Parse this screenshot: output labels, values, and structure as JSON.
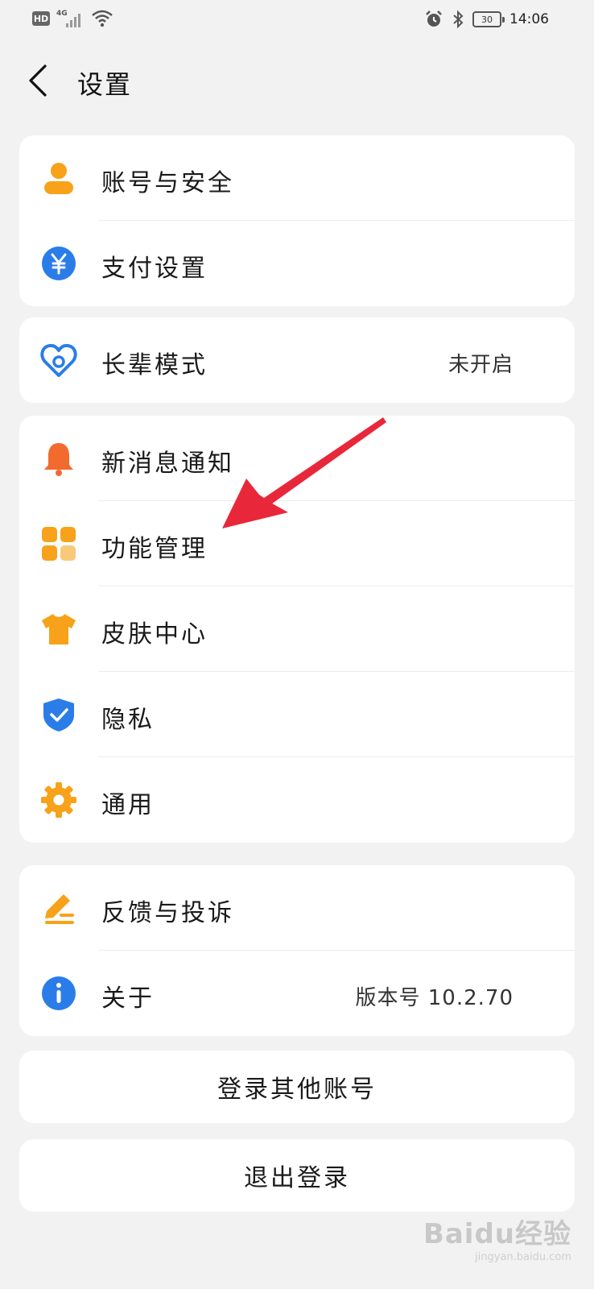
{
  "status_bar": {
    "hd": "HD",
    "network": "4G",
    "battery": "30",
    "time": "14:06"
  },
  "header": {
    "title": "设置"
  },
  "groups": [
    {
      "items": [
        {
          "label": "账号与安全",
          "value": "",
          "icon": "user-icon"
        },
        {
          "label": "支付设置",
          "value": "",
          "icon": "yuan-icon"
        }
      ]
    },
    {
      "items": [
        {
          "label": "长辈模式",
          "value": "未开启",
          "icon": "heart-icon"
        }
      ]
    },
    {
      "items": [
        {
          "label": "新消息通知",
          "value": "",
          "icon": "bell-icon"
        },
        {
          "label": "功能管理",
          "value": "",
          "icon": "grid-icon"
        },
        {
          "label": "皮肤中心",
          "value": "",
          "icon": "shirt-icon"
        },
        {
          "label": "隐私",
          "value": "",
          "icon": "shield-icon"
        },
        {
          "label": "通用",
          "value": "",
          "icon": "gear-icon"
        }
      ]
    },
    {
      "items": [
        {
          "label": "反馈与投诉",
          "value": "",
          "icon": "edit-icon"
        },
        {
          "label": "关于",
          "value": "版本号 10.2.70",
          "icon": "info-icon"
        }
      ]
    }
  ],
  "buttons": {
    "switch_account": "登录其他账号",
    "logout": "退出登录"
  },
  "watermark": {
    "main": "Baidu经验",
    "sub": "jingyan.baidu.com"
  },
  "colors": {
    "orange": "#f7a21a",
    "blue": "#2a7de9",
    "red_orange": "#f26a2e",
    "annotation_red": "#e8283a"
  }
}
